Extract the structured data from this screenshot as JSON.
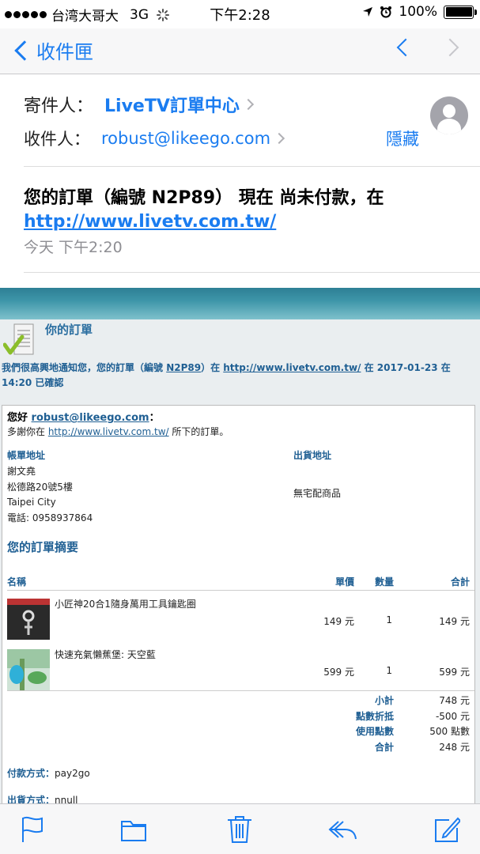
{
  "status_bar": {
    "carrier": "台湾大哥大",
    "network": "3G",
    "time": "下午2:28",
    "battery": "100%",
    "battery_level": 1.0
  },
  "nav": {
    "back_label": "收件匣"
  },
  "header": {
    "from_label": "寄件人：",
    "sender": "LiveTV訂單中心",
    "to_label": "收件人：",
    "recipient": "robust@likeego.com",
    "hide_label": "隱藏",
    "subject_text": "您的訂單（編號 N2P89） 現在 尚未付款，在",
    "subject_link": "http://www.livetv.com.tw/",
    "date": "今天 下午2:20"
  },
  "mail": {
    "title": "你的訂單",
    "intro_1": "我們很高興地通知您，您的訂單（編號 ",
    "order_no": "N2P89",
    "intro_2": "）在 ",
    "intro_link": "http://www.livetv.com.tw/",
    "intro_3": " 在 2017-01-23 在 14:20 已確認",
    "hello_prefix": "您好 ",
    "hello_email": "robust@likeego.com",
    "hello_suffix": "：",
    "thanks_prefix": "多謝你在 ",
    "thanks_link": "http://www.livetv.com.tw/",
    "thanks_suffix": " 所下的訂單。",
    "billing_label": "帳單地址",
    "billing_lines": [
      "謝文堯",
      "松德路20號5樓",
      "Taipei City",
      "電話: 0958937864"
    ],
    "shipping_label": "出貨地址",
    "shipping_value": "無宅配商品",
    "summary_title": "您的訂單摘要",
    "columns": {
      "name": "名稱",
      "price": "單價",
      "qty": "數量",
      "total": "合計"
    },
    "products": [
      {
        "name": "小匠神20合1隨身萬用工具鑰匙圈",
        "price": "149 元",
        "qty": "1",
        "total": "149 元"
      },
      {
        "name": "快速充氣懶蕉堡: 天空藍",
        "price": "599 元",
        "qty": "1",
        "total": "599 元"
      }
    ],
    "totals": [
      {
        "label": "小計",
        "value": "748 元"
      },
      {
        "label": "點數折抵",
        "value": "-500 元"
      },
      {
        "label": "使用點數",
        "value": "500 點數"
      },
      {
        "label": "合計",
        "value": "248 元"
      }
    ],
    "payment_label": "付款方式：",
    "payment_value": "pay2go",
    "shipment_label": "出貨方式：",
    "shipment_value": "nnull"
  },
  "toolbar": {
    "icons": [
      "flag-icon",
      "folder-icon",
      "trash-icon",
      "reply-icon",
      "compose-icon"
    ],
    "accent": "#1a7cf0"
  },
  "colors": {
    "accent": "#1a7cf0",
    "mail_blue": "#1f5f93",
    "teal": "#3d95a8"
  }
}
